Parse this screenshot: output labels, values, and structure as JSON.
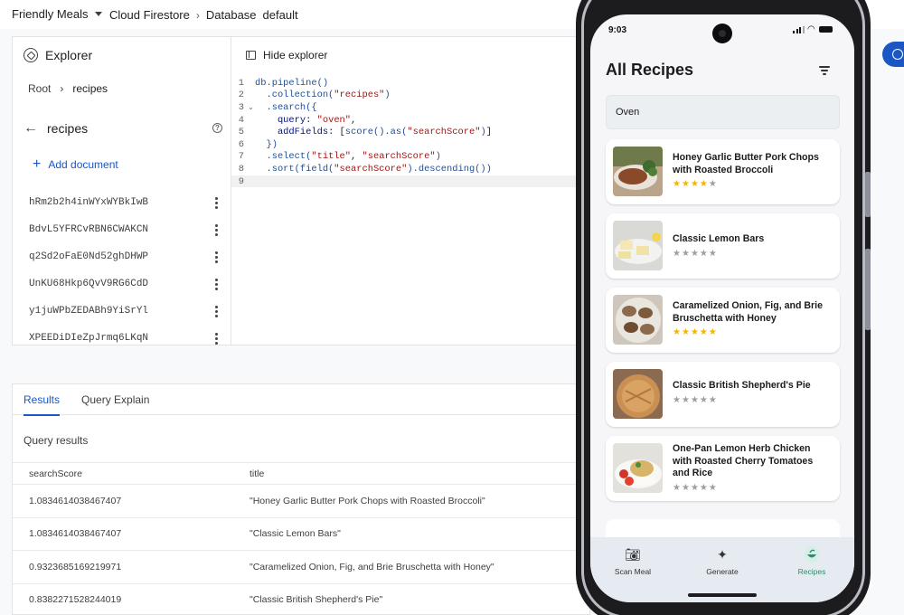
{
  "topbar": {
    "project": "Friendly Meals",
    "breadcrumb": [
      "Cloud Firestore",
      "Database",
      "default"
    ]
  },
  "explorer": {
    "title": "Explorer",
    "hide_label": "Hide explorer",
    "path_root": "Root",
    "path_collection": "recipes",
    "collection_name": "recipes",
    "add_document": "Add document",
    "documents": [
      "hRm2b2h4inWYxWYBkIwB",
      "BdvL5YFRCvRBN6CWAKCN",
      "q2Sd2oFaE0Nd52ghDHWP",
      "UnKU68Hkp6QvV9RG6CdD",
      "y1juWPbZEDABh9YiSrYl",
      "XPEEDiDIeZpJrmq6LKqN"
    ]
  },
  "code": {
    "line_numbers": [
      "1",
      "2",
      "3",
      "4",
      "5",
      "6",
      "7",
      "8",
      "9"
    ]
  },
  "results": {
    "tabs": [
      "Results",
      "Query Explain"
    ],
    "label": "Query results",
    "columns": [
      "searchScore",
      "title"
    ],
    "rows": [
      {
        "score": "1.0834614038467407",
        "title": "\"Honey Garlic Butter Pork Chops with Roasted Broccoli\""
      },
      {
        "score": "1.0834614038467407",
        "title": "\"Classic Lemon Bars\""
      },
      {
        "score": "0.9323685169219971",
        "title": "\"Caramelized Onion, Fig, and Brie Bruschetta with Honey\""
      },
      {
        "score": "0.8382271528244019",
        "title": "\"Classic British Shepherd's Pie\""
      }
    ]
  },
  "phone": {
    "time": "9:03",
    "title": "All Recipes",
    "search_value": "Oven",
    "recipes": [
      {
        "title": "Honey Garlic Butter Pork Chops with Roasted Broccoli",
        "rating": 4
      },
      {
        "title": "Classic Lemon Bars",
        "rating": 0
      },
      {
        "title": "Caramelized Onion, Fig, and Brie Bruschetta with Honey",
        "rating": 5
      },
      {
        "title": "Classic British Shepherd's Pie",
        "rating": 0
      },
      {
        "title": "One-Pan Lemon Herb Chicken with Roasted Cherry Tomatoes and Rice",
        "rating": 0
      }
    ],
    "nav": [
      "Scan Meal",
      "Generate",
      "Recipes"
    ],
    "nav_active": "Recipes",
    "accent_color": "#2e8a6e"
  }
}
